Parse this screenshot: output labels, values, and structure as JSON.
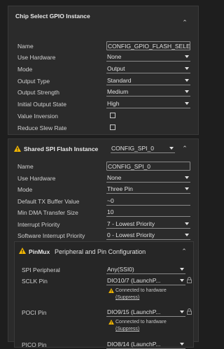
{
  "panel1": {
    "title": "Chip Select GPIO Instance",
    "rows": [
      {
        "label": "Name",
        "value": "CONFIG_GPIO_FLASH_SELECT"
      },
      {
        "label": "Use Hardware",
        "value": "None"
      },
      {
        "label": "Mode",
        "value": "Output"
      },
      {
        "label": "Output Type",
        "value": "Standard"
      },
      {
        "label": "Output Strength",
        "value": "Medium"
      },
      {
        "label": "Initial Output State",
        "value": "High"
      },
      {
        "label": "Value Inversion",
        "checked": false
      },
      {
        "label": "Reduce Slew Rate",
        "checked": false
      }
    ]
  },
  "panel2": {
    "title": "Shared SPI Flash Instance",
    "instance_select": "CONFIG_SPI_0",
    "rows": [
      {
        "label": "Name",
        "value": "CONFIG_SPI_0"
      },
      {
        "label": "Use Hardware",
        "value": "None"
      },
      {
        "label": "Mode",
        "value": "Three Pin"
      },
      {
        "label": "Default TX Buffer Value",
        "value": "~0"
      },
      {
        "label": "Min DMA Transfer Size",
        "value": "10"
      },
      {
        "label": "Interrupt Priority",
        "value": "7 - Lowest Priority"
      },
      {
        "label": "Software Interrupt Priority",
        "value": "0 - Lowest Priority"
      }
    ]
  },
  "pinmux": {
    "badge": "PinMux",
    "title": "Peripheral and Pin Configuration",
    "rows": [
      {
        "label": "SPI Peripheral",
        "value": "Any(SSI0)"
      },
      {
        "label": "SCLK Pin",
        "value": "DIO10/7 (LaunchP..."
      },
      {
        "label": "POCI Pin",
        "value": "DIO9/15 (LaunchP..."
      },
      {
        "label": "PICO Pin",
        "value": "DIO8/14 (LaunchP..."
      }
    ],
    "connected_text": "Connected to hardware",
    "suppress_text": "(Suppress)"
  },
  "colors": {
    "warning": "#f5b800",
    "background": "#1e1e1e",
    "panel": "#2b2b2b"
  }
}
